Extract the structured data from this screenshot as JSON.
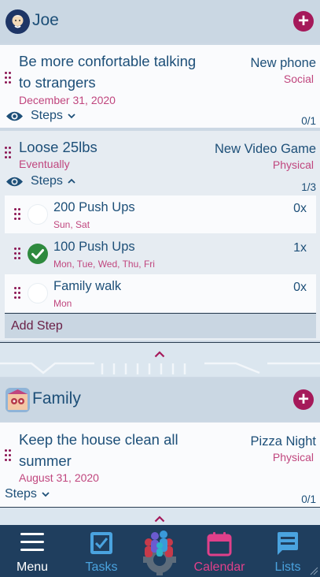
{
  "groups": [
    {
      "name": "Joe",
      "add_label": "+",
      "tasks": [
        {
          "title_line1": "Be more confortable talking",
          "title_line2": "to strangers",
          "date": "December 31, 2020",
          "reward": "New phone",
          "category": "Social",
          "steps_label": "Steps",
          "count": "0/1"
        },
        {
          "title_line1": "Loose 25lbs",
          "date": "Eventually",
          "reward": "New Video Game",
          "category": "Physical",
          "steps_label": "Steps",
          "count": "1/3",
          "steps": [
            {
              "name": "200 Push Ups",
              "days": "Sun, Sat",
              "count": "0x",
              "done": false
            },
            {
              "name": "100 Push Ups",
              "days": "Mon, Tue, Wed, Thu, Fri",
              "count": "1x",
              "done": true
            },
            {
              "name": "Family walk",
              "days": "Mon",
              "count": "0x",
              "done": false
            }
          ],
          "add_step_label": "Add Step"
        }
      ]
    },
    {
      "name": "Family",
      "add_label": "+",
      "tasks": [
        {
          "title_line1": "Keep the house clean all",
          "title_line2": "summer",
          "date": "August 31, 2020",
          "reward": "Pizza Night",
          "category": "Physical",
          "steps_label": "Steps",
          "count": "0/1"
        }
      ]
    }
  ],
  "tabs": [
    {
      "label": "Menu",
      "icon": "menu-icon",
      "color": "#ffffff"
    },
    {
      "label": "Tasks",
      "icon": "tasks-check-icon",
      "color": "#4aa3df"
    },
    {
      "label": "",
      "icon": "family-gear-logo-icon",
      "color": "#ffffff"
    },
    {
      "label": "Calendar",
      "icon": "calendar-icon",
      "color": "#e0408a"
    },
    {
      "label": "Lists",
      "icon": "lists-icon",
      "color": "#4aa3df"
    }
  ],
  "colors": {
    "accent": "#a5195a",
    "primary_text": "#1d4f78",
    "secondary_text": "#c0467e",
    "tabbar": "#1f3e5e",
    "done": "#2e8a3e"
  }
}
